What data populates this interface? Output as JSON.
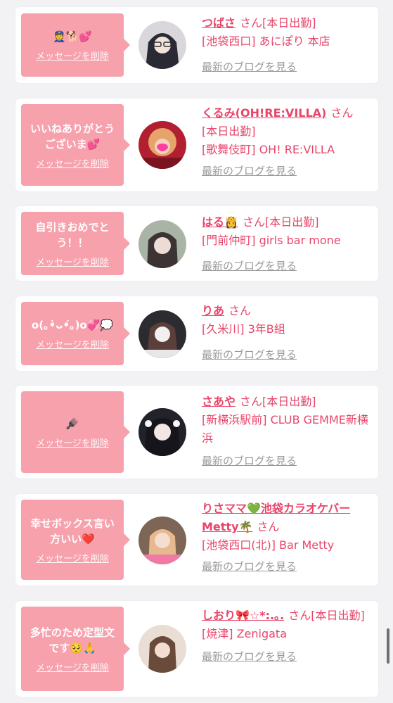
{
  "cards": [
    {
      "message": "👮🐕💕",
      "delete_label": "メッセージを削除",
      "name": "つばさ",
      "san": "さん",
      "status": "[本日出勤]",
      "shop": "[池袋西口] あにぽり 本店",
      "blog": "最新のブログを見る",
      "avatar_color": "#3a3a46"
    },
    {
      "message": "いいねありがとうございま💕",
      "delete_label": "メッセージを削除",
      "name": "くるみ(OH!RE:VILLA)",
      "san": "さん",
      "status": "[本日出勤]",
      "shop": "[歌舞伎町] OH! RE:VILLA",
      "blog": "最新のブログを見る",
      "avatar_color": "#c0283a"
    },
    {
      "message": "自引きおめでとう！！",
      "delete_label": "メッセージを削除",
      "name": "はる👸",
      "san": "さん",
      "status": "[本日出勤]",
      "shop": "[門前仲町] girls bar mone",
      "blog": "最新のブログを見る",
      "avatar_color": "#9aa598"
    },
    {
      "message": "o(｡•̀ᴗ•́｡)o💞💭",
      "delete_label": "メッセージを削除",
      "name": "りあ",
      "san": "さん",
      "status": "",
      "shop": "[久米川] 3年B組",
      "blog": "最新のブログを見る",
      "avatar_color": "#2a2a2e"
    },
    {
      "message": "🪮",
      "delete_label": "メッセージを削除",
      "name": "さあや",
      "san": "さん",
      "status": "[本日出勤]",
      "shop": "[新横浜駅前] CLUB GEMME新横浜",
      "blog": "最新のブログを見る",
      "avatar_color": "#1e1e24"
    },
    {
      "message": "幸せボックス言い方いい❤️",
      "delete_label": "メッセージを削除",
      "name": "りさママ💚池袋カラオケバーMetty🌴",
      "san": "さん",
      "status": "",
      "shop": "[池袋西口(北)] Bar Metty",
      "blog": "最新のブログを見る",
      "avatar_color": "#8a6a58"
    },
    {
      "message": "多忙のため定型文です🥺🙏",
      "delete_label": "メッセージを削除",
      "name": "しおり🎀☆*:.｡.",
      "san": "さん",
      "status": "[本日出勤]",
      "shop": "[焼津] Zenigata",
      "blog": "最新のブログを見る",
      "avatar_color": "#d8c7bb"
    }
  ]
}
